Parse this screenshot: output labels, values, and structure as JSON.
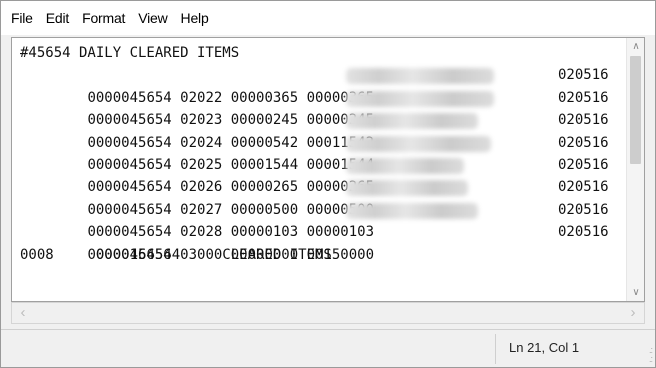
{
  "menu": {
    "items": [
      {
        "label": "File"
      },
      {
        "label": "Edit"
      },
      {
        "label": "Format"
      },
      {
        "label": "View"
      },
      {
        "label": "Help"
      }
    ]
  },
  "document": {
    "header": "#45654 DAILY CLEARED ITEMS",
    "rows": [
      {
        "text": "0000045654 02022 00000365 00000365",
        "redacted": true,
        "tail": "020516"
      },
      {
        "text": "0000045654 02023 00000245 00000245",
        "redacted": true,
        "tail": "020516"
      },
      {
        "text": "0000045654 02024 00000542 00011542",
        "redacted": true,
        "tail": "020516"
      },
      {
        "text": "0000045654 02025 00001544 00001544",
        "redacted": true,
        "tail": "020516"
      },
      {
        "text": "0000045654 02026 00000265 00000265",
        "redacted": true,
        "tail": "020516"
      },
      {
        "text": "0000045654 02027 00000500 00000500",
        "redacted": true,
        "tail": "020516"
      },
      {
        "text": "0000045654 02028 00000103 00000103",
        "redacted": true,
        "tail": "020516"
      },
      {
        "text": "0000045654 03000 00000000 00150000",
        "redacted": false,
        "tail": "020516"
      }
    ],
    "footer": "0008     0000164564     CLEARED ITEMS"
  },
  "status": {
    "position": "Ln 21, Col 1"
  },
  "icons": {
    "scroll_up": "chevron-up-icon",
    "scroll_down": "chevron-down-icon",
    "scroll_left": "chevron-left-icon",
    "scroll_right": "chevron-right-icon",
    "resize_grip": "resize-grip-icon"
  }
}
